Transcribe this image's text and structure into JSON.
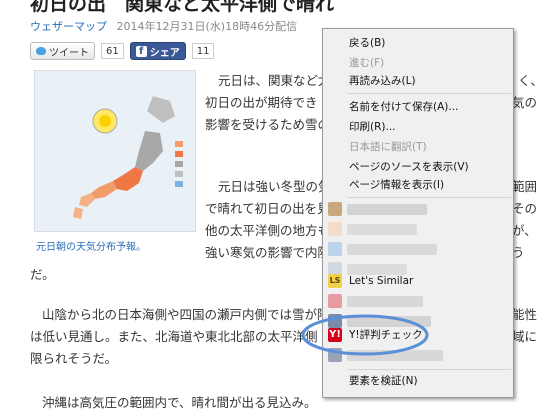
{
  "article": {
    "headline": "初日の出　関東など太平洋側で晴れ",
    "source": "ウェザーマップ",
    "date": "2014年12月31日(水)18時46分配信",
    "tweet_label": "ツイート",
    "tweet_count": "61",
    "share_label": "シェア",
    "share_count": "11",
    "map_caption": "元日朝の天気分布予報。",
    "p1": [
      "元日は、関東など太",
      "初日の出が期待でき",
      "影響を受けるため雪の"
    ],
    "p1_right": [
      "く、",
      "気の"
    ],
    "p2": [
      "元日は強い冬型の気",
      "で晴れて初日の出を見",
      "他の太平洋側の地方も",
      "強い寒気の影響で内陸"
    ],
    "p2_right": [
      "範囲",
      "その",
      "が、",
      "う"
    ],
    "p2_end": "だ。",
    "p3": [
      "山陰から北の日本海側や四国の瀬戸内側では雪が降",
      "は低い見通し。また、北海道や東北北部の太平洋側",
      "限られそうだ。"
    ],
    "p3_right": [
      "能性",
      "域に"
    ],
    "p4": "沖縄は高気圧の範囲内で、晴れ間が出る見込み。"
  },
  "context_menu": {
    "back": "戻る(B)",
    "forward": "進む(F)",
    "reload": "再読み込み(L)",
    "save_as": "名前を付けて保存(A)...",
    "print": "印刷(R)...",
    "translate": "日本語に翻訳(T)",
    "view_source": "ページのソースを表示(V)",
    "page_info": "ページ情報を表示(I)",
    "lets_similar": "Let's Similar",
    "y_check": "Y!評判チェック",
    "inspect": "要素を検証(N)",
    "highlight_color": "#5b8fd8"
  }
}
